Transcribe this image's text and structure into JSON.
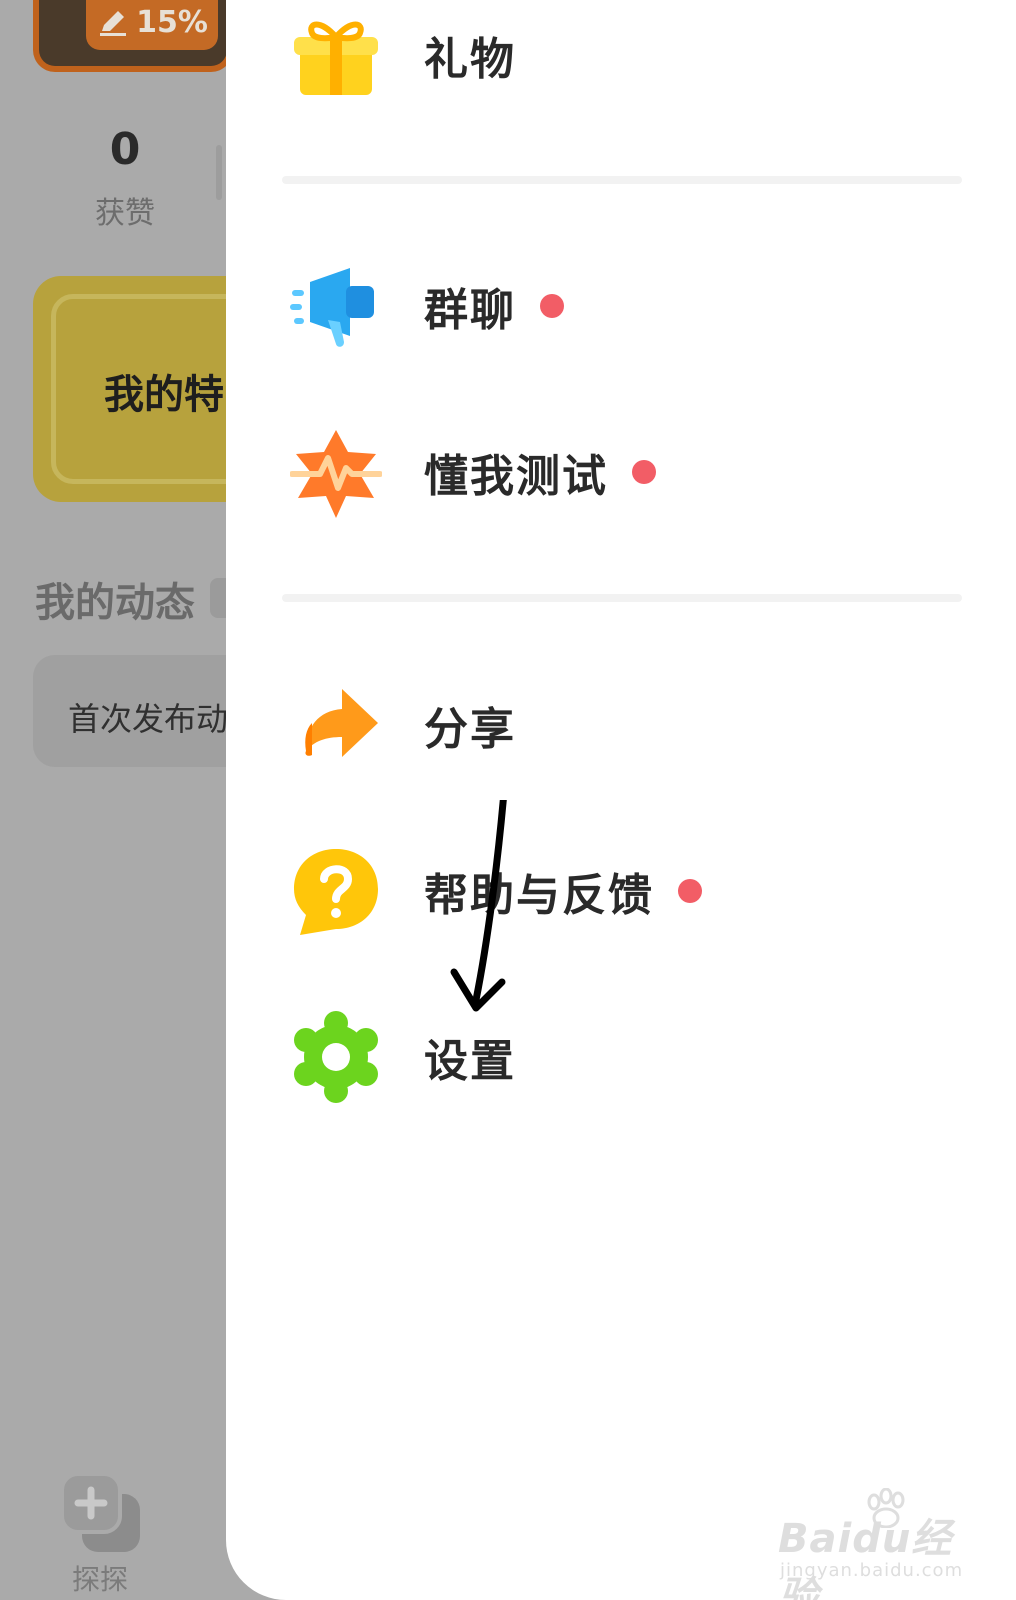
{
  "background": {
    "progress_badge": "15%",
    "stats": {
      "likes_count": "0",
      "likes_label": "获赞"
    },
    "feature_card_text": "我的特",
    "section_title": "我的动态",
    "first_post_text": "首次发布动",
    "bottom_tab_label": "探探"
  },
  "drawer": {
    "menu": [
      {
        "label": "礼物",
        "icon": "gift-icon",
        "badge": false
      },
      {
        "label": "群聊",
        "icon": "megaphone-icon",
        "badge": true
      },
      {
        "label": "懂我测试",
        "icon": "pulse-star-icon",
        "badge": true
      },
      {
        "label": "分享",
        "icon": "share-arrow-icon",
        "badge": false
      },
      {
        "label": "帮助与反馈",
        "icon": "help-question-icon",
        "badge": true
      },
      {
        "label": "设置",
        "icon": "gear-icon",
        "badge": false
      }
    ]
  },
  "watermark": {
    "main": "Baidu经验",
    "sub": "jingyan.baidu.com"
  },
  "colors": {
    "badge_red": "#f25d66",
    "gift_yellow": "#ffd21e",
    "megaphone_blue": "#2aa8f0",
    "pulse_orange": "#ff7a2a",
    "share_orange": "#ff9a1a",
    "help_yellow": "#ffc60a",
    "gear_green": "#6cd41e"
  }
}
